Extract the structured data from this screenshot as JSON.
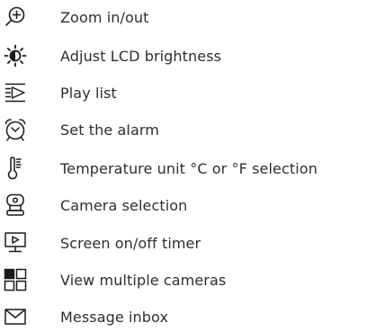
{
  "items": [
    {
      "icon": "zoom-icon",
      "label": "Zoom in/out"
    },
    {
      "icon": "brightness-icon",
      "label": "Adjust LCD brightness"
    },
    {
      "icon": "playlist-icon",
      "label": "Play list"
    },
    {
      "icon": "alarm-clock-icon",
      "label": "Set the alarm"
    },
    {
      "icon": "thermometer-icon",
      "label": "Temperature unit °C or °F selection"
    },
    {
      "icon": "camera-icon",
      "label": "Camera selection"
    },
    {
      "icon": "screen-timer-icon",
      "label": "Screen on/off timer"
    },
    {
      "icon": "multi-camera-grid-icon",
      "label": "View multiple cameras"
    },
    {
      "icon": "envelope-icon",
      "label": "Message inbox"
    }
  ],
  "colors": {
    "text": "#2e2e2e",
    "icon": "#1a1a1a",
    "background": "#ffffff"
  }
}
